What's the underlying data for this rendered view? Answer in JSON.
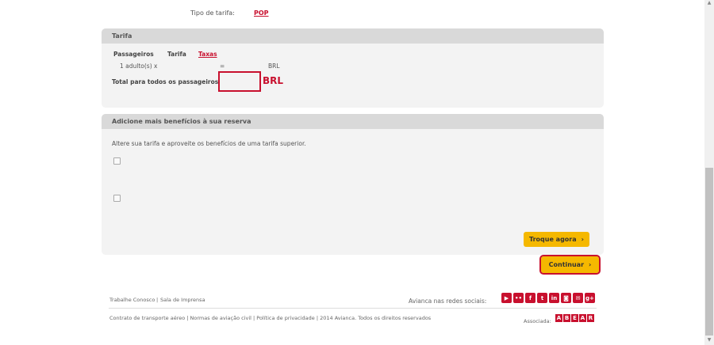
{
  "fare_type": {
    "label": "Tipo de tarifa:",
    "value": "POP"
  },
  "tarifa_panel": {
    "title": "Tarifa",
    "col_passengers": "Passageiros",
    "col_tarifa": "Tarifa",
    "col_taxas": "Taxas",
    "row_passenger": "1 adulto(s) x",
    "row_equals": "=",
    "row_currency": "BRL",
    "total_label": "Total para todos os passageiros",
    "total_value": "",
    "total_currency": "BRL"
  },
  "benefits_panel": {
    "title": "Adicione mais benefícios à sua reserva",
    "description": "Altere sua tarifa e aproveite os benefícios de uma tarifa superior.",
    "troque_label": "Troque agora",
    "chevron": "›"
  },
  "continuar_label": "Continuar",
  "footer": {
    "link1": "Trabalhe Conosco",
    "sep1": "|",
    "link2": "Sala de Imprensa",
    "social_label": "Avianca nas redes sociais:",
    "social_icons": [
      "youtube-icon",
      "flickr-icon",
      "facebook-icon",
      "twitter-icon",
      "linkedin-icon",
      "instagram-icon",
      "mail-icon",
      "google-plus-icon"
    ],
    "legal": "Contrato de transporte aéreo | Normas de aviação civil | Política de privacidade | 2014 Avianca. Todos os direitos reservados",
    "assoc_label": "Associada:",
    "abear_letters": [
      "A",
      "B",
      "E",
      "A",
      "R"
    ]
  },
  "colors": {
    "accent_red": "#c8102e",
    "button_yellow": "#f5b800",
    "panel_bg": "#f3f3f3",
    "panel_header": "#d9d9d9"
  }
}
